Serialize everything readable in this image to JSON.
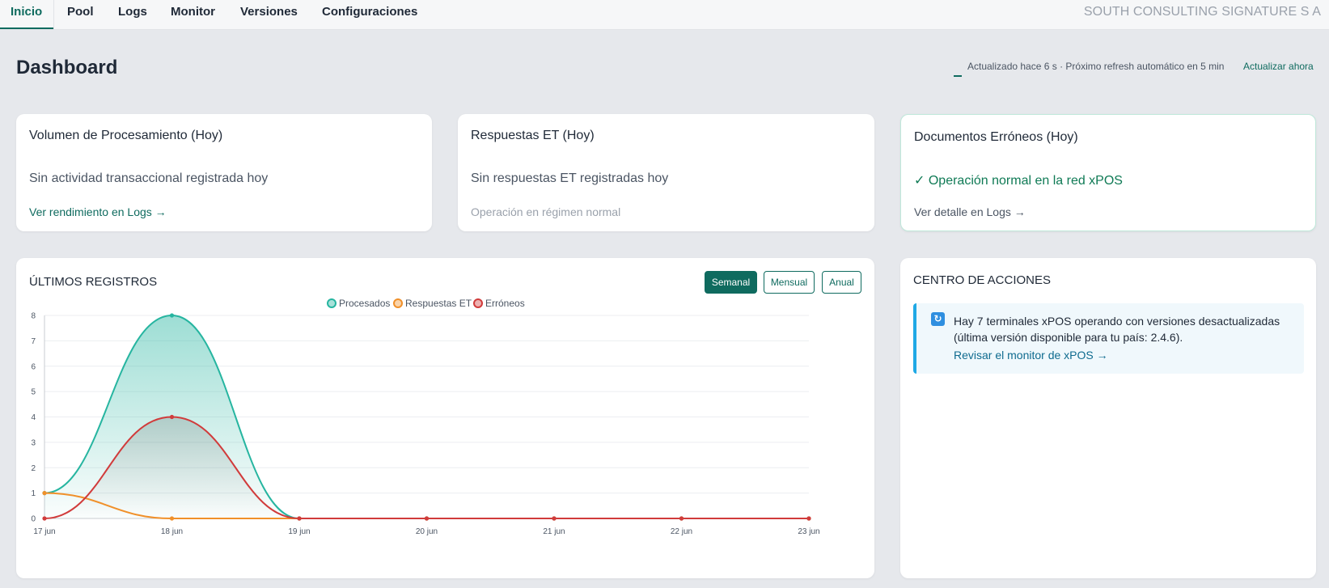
{
  "nav": {
    "tabs": [
      {
        "label": "Inicio",
        "active": true
      },
      {
        "label": "Pool"
      },
      {
        "label": "Logs"
      },
      {
        "label": "Monitor"
      },
      {
        "label": "Versiones"
      },
      {
        "label": "Configuraciones"
      }
    ],
    "company": "SOUTH CONSULTING SIGNATURE S A"
  },
  "header": {
    "title": "Dashboard",
    "refresh_info": "Actualizado hace 6 s · Próximo refresh automático en 5 min",
    "refresh_action": "Actualizar ahora"
  },
  "cards": {
    "volumen": {
      "title": "Volumen de Procesamiento (Hoy)",
      "message": "Sin actividad transaccional registrada hoy",
      "link": "Ver rendimiento en Logs →"
    },
    "respuestas": {
      "title": "Respuestas ET (Hoy)",
      "message": "Sin respuestas ET registradas hoy",
      "sub": "Operación en régimen normal"
    },
    "erroneos": {
      "title": "Documentos Erróneos (Hoy)",
      "message": "✓ Operación normal en la red xPOS",
      "link": "Ver detalle en Logs →"
    }
  },
  "registros": {
    "title": "ÚLTIMOS REGISTROS",
    "periods": [
      {
        "label": "Semanal",
        "active": true
      },
      {
        "label": "Mensual"
      },
      {
        "label": "Anual"
      }
    ]
  },
  "chart_data": {
    "type": "area",
    "categories": [
      "17 jun",
      "18 jun",
      "19 jun",
      "20 jun",
      "21 jun",
      "22 jun",
      "23 jun"
    ],
    "series": [
      {
        "name": "Procesados",
        "values": [
          1,
          8,
          0,
          0,
          0,
          0,
          0
        ],
        "color": "#26b5a0",
        "filled": true
      },
      {
        "name": "Respuestas ET",
        "values": [
          1,
          0,
          0,
          0,
          0,
          0,
          0
        ],
        "color": "#f0902a"
      },
      {
        "name": "Erróneos",
        "values": [
          0,
          4,
          0,
          0,
          0,
          0,
          0
        ],
        "color": "#d13b3b",
        "filled": true
      }
    ],
    "yticks": [
      "0",
      "1",
      "2",
      "3",
      "4",
      "5",
      "6",
      "7",
      "8"
    ],
    "ylim": [
      0,
      8
    ],
    "grid": true,
    "legend": "top-center"
  },
  "actions": {
    "title": "CENTRO DE ACCIONES",
    "notice": {
      "icon": "refresh-icon",
      "text": "Hay 7 terminales xPOS operando con versiones desactualizadas (última versión disponible para tu país: 2.4.6).",
      "link": "Revisar el monitor de xPOS →"
    }
  },
  "colors": {
    "accent": "#0f6b5f",
    "info": "#1fa9e5",
    "success": "#0f7a55"
  }
}
